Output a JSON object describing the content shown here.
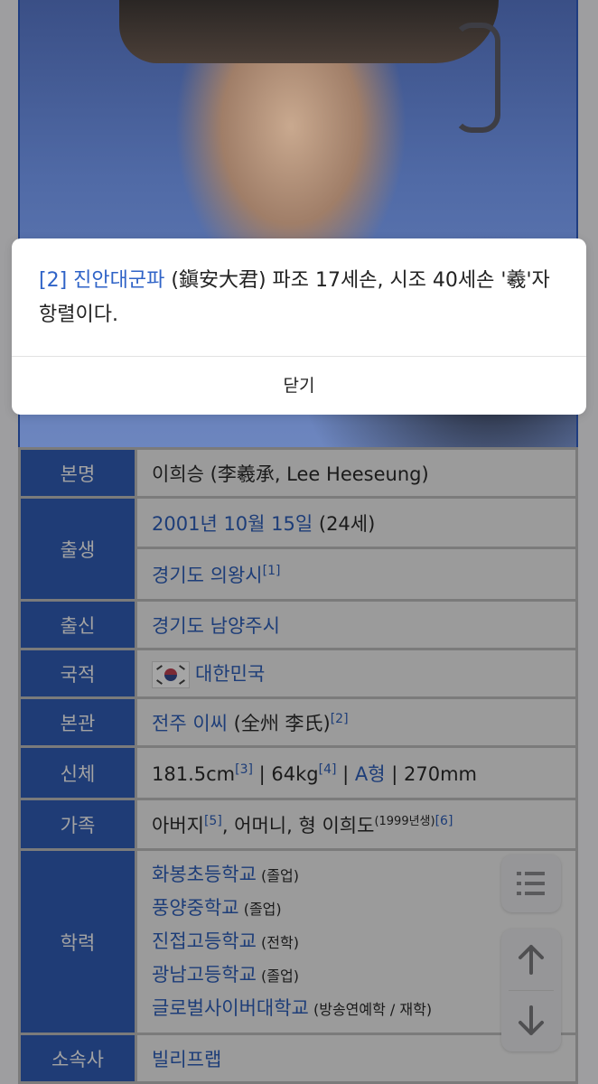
{
  "footnote_modal": {
    "ref_marker": "[2]",
    "ref_link_text": "진안대군파",
    "text_part1": " (鎭安大君) 파조 17세손, 시조 40세손 '羲'자 항렬이다.",
    "close_label": "닫기"
  },
  "infobox": {
    "real_name": {
      "label": "본명",
      "value": "이희승 (李羲承, Lee Heeseung)"
    },
    "birth": {
      "label": "출생",
      "date_link": "2001년 10월 15일",
      "age": " (24세)",
      "place_link": "경기도 의왕시",
      "place_ref": "[1]"
    },
    "origin": {
      "label": "출신",
      "value_link": "경기도 남양주시"
    },
    "nationality": {
      "label": "국적",
      "value_link": "대한민국",
      "flag_icon": "south-korea-flag-icon"
    },
    "ancestral_home": {
      "label": "본관",
      "value_link": "전주 이씨",
      "hanja": " (全州 李氏)",
      "ref": "[2]"
    },
    "body": {
      "label": "신체",
      "height": "181.5cm",
      "height_ref": "[3]",
      "sep1": " | 64kg",
      "weight_ref": "[4]",
      "sep2": " | ",
      "blood_link": "A형",
      "shoe": " | 270mm"
    },
    "family": {
      "label": "가족",
      "father": "아버지",
      "father_ref": "[5]",
      "rest": ", 어머니, 형 이희도",
      "sibling_note": "(1999년생)",
      "family_ref": "[6]"
    },
    "education": {
      "label": "학력",
      "schools": [
        {
          "name": "화봉초등학교",
          "status": " (졸업)"
        },
        {
          "name": "풍양중학교",
          "status": " (졸업)"
        },
        {
          "name": "진접고등학교",
          "status": " (전학)"
        },
        {
          "name": "광남고등학교",
          "status": " (졸업)"
        },
        {
          "name": "글로벌사이버대학교",
          "status": " (방송연예학 / 재학)"
        }
      ]
    },
    "agency": {
      "label": "소속사",
      "value_link": "빌리프랩"
    }
  },
  "floating_buttons": {
    "toc_icon": "list-icon",
    "up_icon": "arrow-up-icon",
    "down_icon": "arrow-down-icon"
  }
}
